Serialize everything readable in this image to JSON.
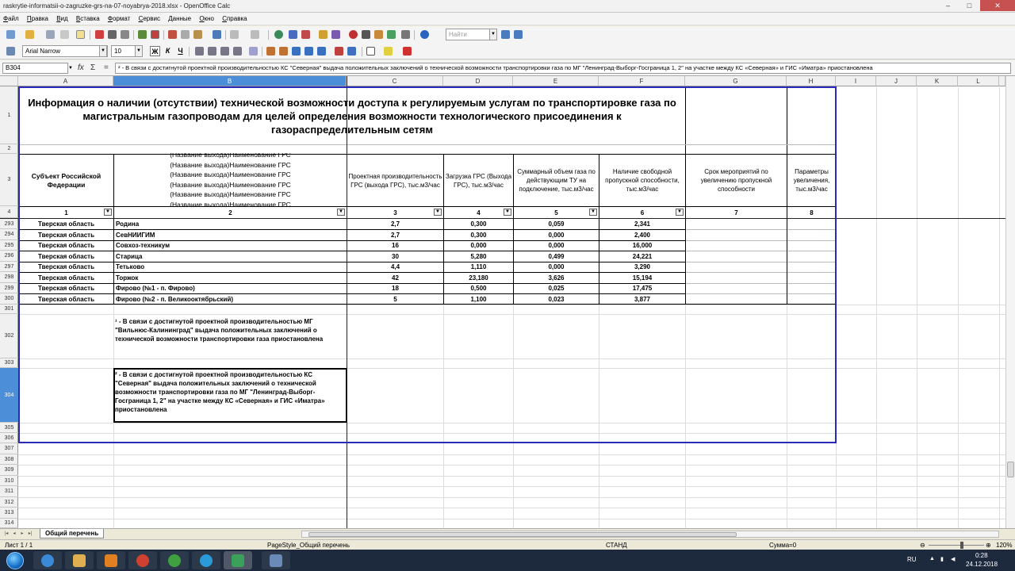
{
  "window": {
    "title": "raskrytie-informatsii-o-zagruzke-grs-na-07-noyabrya-2018.xlsx - OpenOffice Calc",
    "controls": [
      "–",
      "□",
      "✕"
    ]
  },
  "menu": [
    "Файл",
    "Правка",
    "Вид",
    "Вставка",
    "Формат",
    "Сервис",
    "Данные",
    "Окно",
    "Справка"
  ],
  "toolbar": {
    "find_placeholder": "Найти",
    "font_name": "Arial Narrow",
    "font_size": "10",
    "bold": "Ж",
    "italic": "К",
    "underline": "Ч"
  },
  "formula_bar": {
    "cell_ref": "B304",
    "fx": "fx",
    "sum": "Σ",
    "eq": "=",
    "content": "² -  В связи с достигнутой проектной производительностью КС \"Северная\" выдача положительных заключений о  технической возможности транспортировки газа по МГ \"Ленинград-Выборг-Госграница 1, 2\" на участке между КС «Северная» и ГИС «Иматра» приостановлена"
  },
  "columns": [
    "A",
    "B",
    "C",
    "D",
    "E",
    "F",
    "G",
    "H",
    "I",
    "J",
    "K",
    "L"
  ],
  "rows_top": [
    "1",
    "2",
    "3",
    "4"
  ],
  "sheet": {
    "title": "Информация о наличии (отсутствии) технической возможности доступа к регулируемым услугам по транспортировке газа по магистральным газопроводам для целей определения возможности технологического присоединения к газораспределительным сетям",
    "headers": {
      "a": "Субъект Российской Федерации",
      "b": "(Название выхода)Наименование ГРС\n(Название выхода)Наименование ГРС\n(Название выхода)Наименование ГРС\n(Название выхода)Наименование ГРС\n(Название выхода)Наименование ГРС\n(Название выхода)Наименование ГРС",
      "c": "Проектная производительность ГРС (выхода ГРС), тыс.м3/час",
      "d": "Загрузка ГРС (Выхода ГРС), тыс.м3/час",
      "e": "Суммарный объем газа по действующим ТУ на подключение, тыс.м3/час",
      "f": "Наличие свободной пропускной способности, тыс.м3/час",
      "g": "Срок мероприятий по увеличению пропускной способности",
      "h": "Параметры увеличения, тыс.м3/час"
    },
    "colnums": [
      "1",
      "2",
      "3",
      "4",
      "5",
      "6",
      "7",
      "8"
    ],
    "rows": [
      {
        "num": "293",
        "region": "Тверская область",
        "name": "Родина",
        "cap": "2,7",
        "load": "0,300",
        "tu": "0,059",
        "free": "2,341"
      },
      {
        "num": "294",
        "region": "Тверская область",
        "name": "СевНИИГИМ",
        "cap": "2,7",
        "load": "0,300",
        "tu": "0,000",
        "free": "2,400"
      },
      {
        "num": "295",
        "region": "Тверская область",
        "name": "Совхоз-техникум",
        "cap": "16",
        "load": "0,000",
        "tu": "0,000",
        "free": "16,000"
      },
      {
        "num": "296",
        "region": "Тверская область",
        "name": "Старица",
        "cap": "30",
        "load": "5,280",
        "tu": "0,499",
        "free": "24,221"
      },
      {
        "num": "297",
        "region": "Тверская область",
        "name": "Тетьково",
        "cap": "4,4",
        "load": "1,110",
        "tu": "0,000",
        "free": "3,290"
      },
      {
        "num": "298",
        "region": "Тверская область",
        "name": "Торжок",
        "cap": "42",
        "load": "23,180",
        "tu": "3,626",
        "free": "15,194"
      },
      {
        "num": "299",
        "region": "Тверская область",
        "name": "Фирово (№1 - п. Фирово)",
        "cap": "18",
        "load": "0,500",
        "tu": "0,025",
        "free": "17,475"
      },
      {
        "num": "300",
        "region": "Тверская область",
        "name": "Фирово (№2 - п. Великооктябрьский)",
        "cap": "5",
        "load": "1,100",
        "tu": "0,023",
        "free": "3,877"
      }
    ],
    "note1": "¹ - В связи с достигнутой проектной производительностью МГ \"Вильнюс-Калининград\" выдача положительных заключений о  технической возможности транспортировки газа приостановлена",
    "note2": "² -  В связи с достигнутой проектной производительностью КС \"Северная\" выдача положительных заключений о технической возможности транспортировки газа по МГ \"Ленинград-Выборг-Госграница 1, 2\" на участке между КС «Северная» и ГИС «Иматра» приостановлена",
    "extra_rows": [
      "301",
      "302",
      "303",
      "304",
      "305",
      "306",
      "307",
      "308",
      "309",
      "310",
      "311",
      "312",
      "313",
      "314"
    ]
  },
  "tabs": {
    "sheet_tab": "Общий перечень"
  },
  "status": {
    "sheet": "Лист 1 / 1",
    "page_style": "PageStyle_Общий перечень",
    "mode": "СТАНД",
    "sum": "Сумма=0",
    "zoom": "120%",
    "zoom_level": 0.6
  },
  "taskbar": {
    "lang": "RU",
    "time": "0:28",
    "date": "24.12.2018"
  }
}
